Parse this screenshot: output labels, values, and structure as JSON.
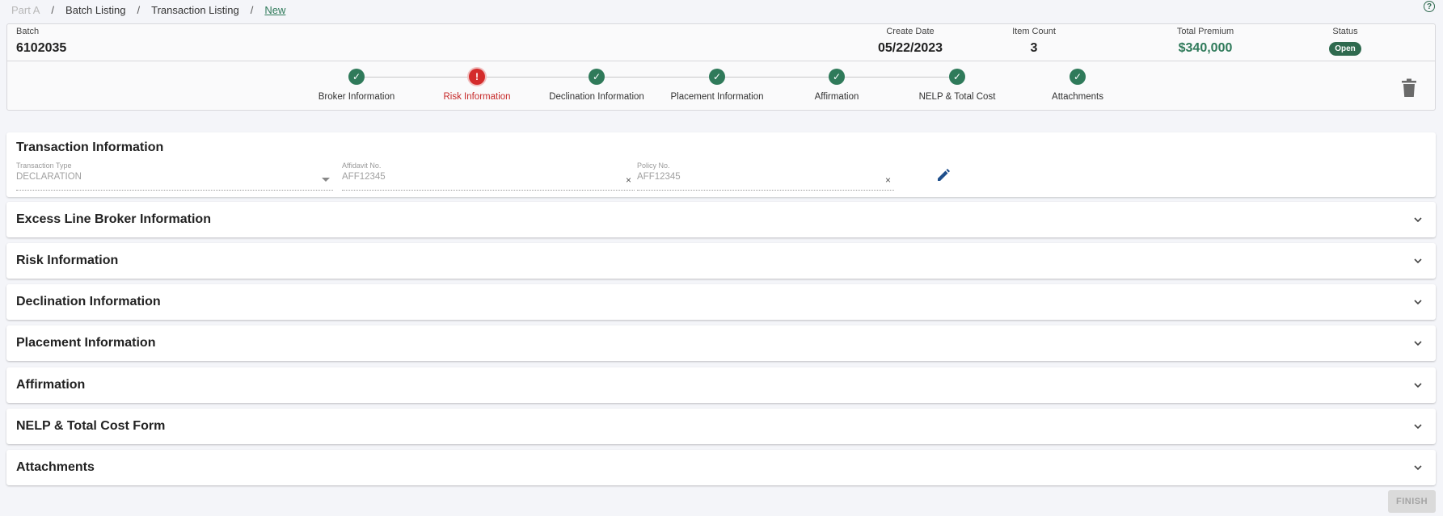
{
  "breadcrumb": {
    "items": [
      {
        "label": "Part A",
        "state": "disabled"
      },
      {
        "label": "Batch Listing",
        "state": "link"
      },
      {
        "label": "Transaction Listing",
        "state": "link"
      },
      {
        "label": "New",
        "state": "current"
      }
    ],
    "separator": "/"
  },
  "help": {
    "glyph": "?"
  },
  "batch": {
    "batch_label": "Batch",
    "batch_value": "6102035",
    "create_date_label": "Create Date",
    "create_date_value": "05/22/2023",
    "item_count_label": "Item Count",
    "item_count_value": "3",
    "total_premium_label": "Total Premium",
    "total_premium_value": "$340,000",
    "status_label": "Status",
    "status_value": "Open"
  },
  "stepper": {
    "steps": [
      {
        "label": "Broker Information",
        "state": "complete"
      },
      {
        "label": "Risk Information",
        "state": "error"
      },
      {
        "label": "Declination Information",
        "state": "complete"
      },
      {
        "label": "Placement Information",
        "state": "complete"
      },
      {
        "label": "Affirmation",
        "state": "complete"
      },
      {
        "label": "NELP & Total Cost",
        "state": "complete"
      },
      {
        "label": "Attachments",
        "state": "complete"
      }
    ],
    "check_glyph": "✓",
    "error_glyph": "!"
  },
  "transaction": {
    "title": "Transaction Information",
    "type_label": "Transaction Type",
    "type_value": "DECLARATION",
    "affidavit_label": "Affidavit No.",
    "affidavit_value": "AFF12345",
    "policy_label": "Policy No.",
    "policy_value": "AFF12345",
    "clear_glyph": "×"
  },
  "sections": [
    "Excess Line Broker Information",
    "Risk Information",
    "Declination Information",
    "Placement Information",
    "Affirmation",
    "NELP & Total Cost Form",
    "Attachments"
  ],
  "actions": {
    "finish_label": "FINISH"
  },
  "colors": {
    "accent_green": "#2f7a5a",
    "error_red": "#d42b2b",
    "edit_blue": "#1e4f8c",
    "disabled_gray": "#dadada"
  }
}
